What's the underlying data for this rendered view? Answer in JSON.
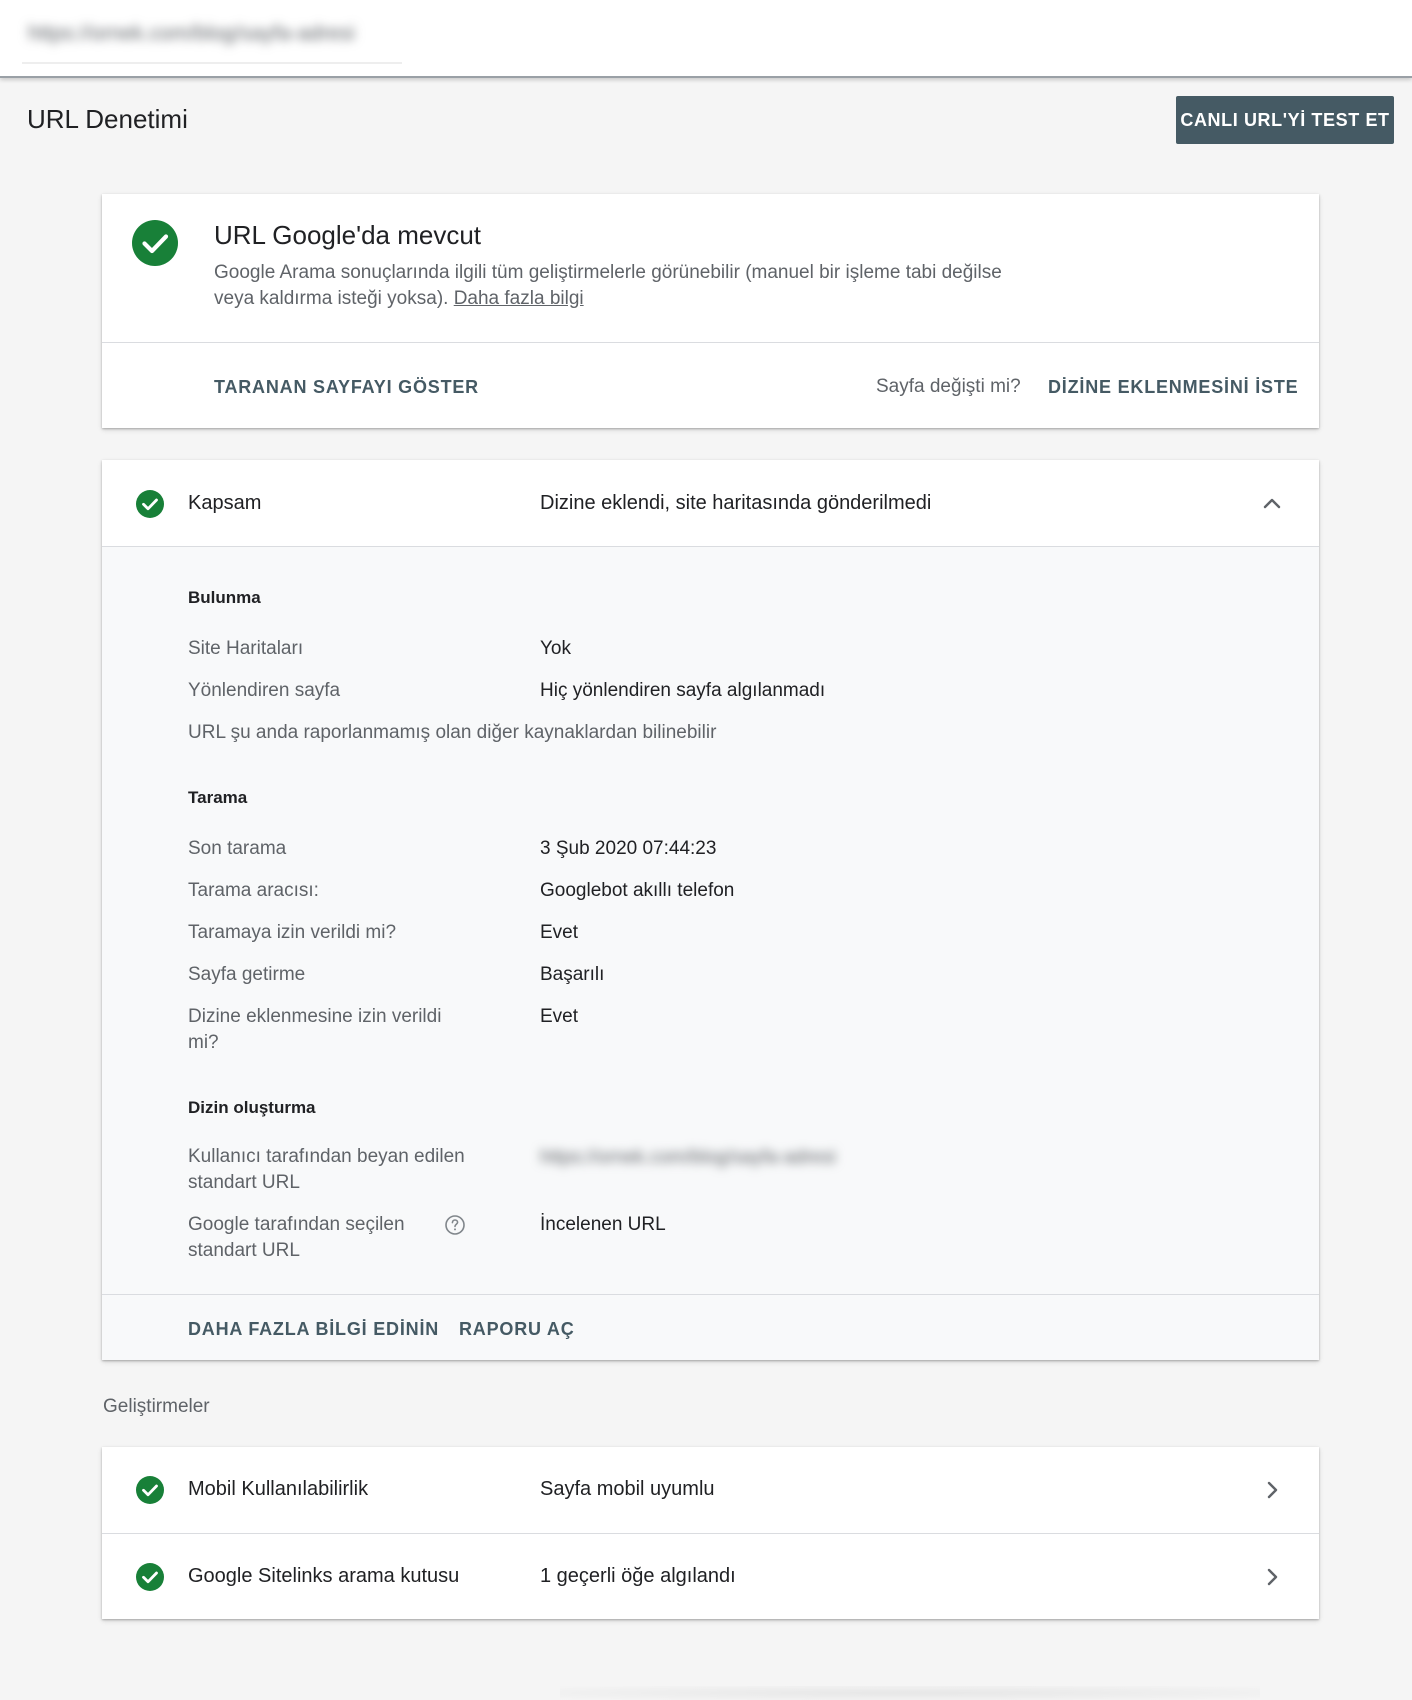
{
  "topbar": {
    "url": "https://ornek.com/blog/sayfa-adresi"
  },
  "page": {
    "title": "URL Denetimi",
    "test_live_button": "CANLI URL'Yİ TEST ET"
  },
  "status": {
    "title": "URL Google'da mevcut",
    "desc": "Google Arama sonuçlarında ilgili tüm geliştirmelerle görünebilir (manuel bir işleme tabi değilse veya kaldırma isteği yoksa).",
    "learn_more": "Daha fazla bilgi",
    "view_crawled": "TARANAN SAYFAYI GÖSTER",
    "page_changed": "Sayfa değişti mi?",
    "request_indexing": "DİZİNE EKLENMESİNİ İSTE"
  },
  "coverage": {
    "title": "Kapsam",
    "value": "Dizine eklendi, site haritasında gönderilmedi",
    "discovery": {
      "heading": "Bulunma",
      "sitemaps_label": "Site Haritaları",
      "sitemaps_value": "Yok",
      "referring_label": "Yönlendiren sayfa",
      "referring_value": "Hiç yönlendiren sayfa algılanmadı",
      "note": "URL şu anda raporlanmamış olan diğer kaynaklardan bilinebilir"
    },
    "crawl": {
      "heading": "Tarama",
      "last_crawl_label": "Son tarama",
      "last_crawl_value": "3 Şub 2020 07:44:23",
      "crawled_as_label": "Tarama aracısı:",
      "crawled_as_value": "Googlebot akıllı telefon",
      "crawl_allowed_label": "Taramaya izin verildi mi?",
      "crawl_allowed_value": "Evet",
      "fetch_label": "Sayfa getirme",
      "fetch_value": "Başarılı",
      "index_allowed_label": "Dizine eklenmesine izin verildi mi?",
      "index_allowed_value": "Evet"
    },
    "indexing": {
      "heading": "Dizin oluşturma",
      "user_canonical_label": "Kullanıcı tarafından beyan edilen standart URL",
      "user_canonical_value": "https://ornek.com/blog/sayfa-adresi",
      "google_canonical_label": "Google tarafından seçilen standart URL",
      "google_canonical_value": "İncelenen URL"
    },
    "learn_more": "DAHA FAZLA BİLGİ EDİNİN",
    "open_report": "RAPORU AÇ"
  },
  "enhancements": {
    "heading": "Geliştirmeler",
    "items": [
      {
        "title": "Mobil Kullanılabilirlik",
        "value": "Sayfa mobil uyumlu"
      },
      {
        "title": "Google Sitelinks arama kutusu",
        "value": "1 geçerli öğe algılandı"
      }
    ]
  },
  "colors": {
    "success": "#188038",
    "button_bg": "#455a64",
    "link": "#455a64"
  },
  "icons": [
    "check-circle-icon",
    "chevron-up-icon",
    "help-icon",
    "chevron-right-icon"
  ]
}
